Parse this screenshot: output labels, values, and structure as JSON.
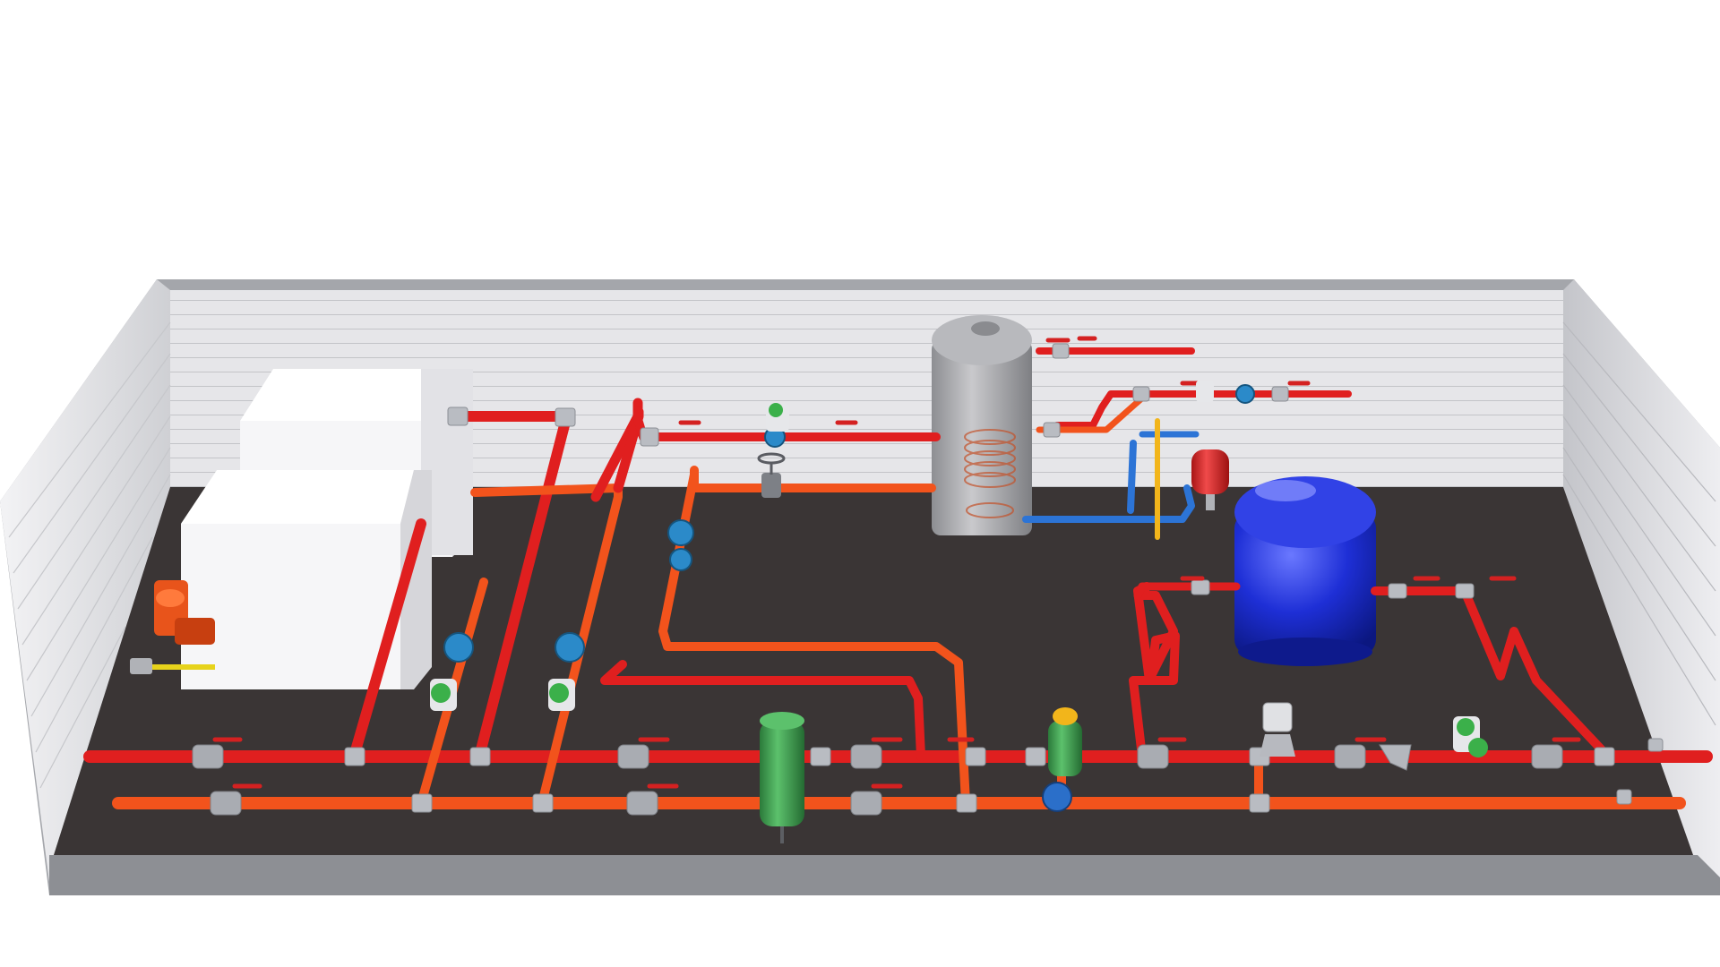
{
  "scene": {
    "subject": "boiler-room-piping-layout",
    "colors": {
      "background": "#ffffff",
      "wall_panel": "#e9e9ec",
      "wall_edge": "#9fa1a6",
      "floor": "#3a3535",
      "pipe_hot": "#e01f1f",
      "pipe_return": "#f2531c",
      "pipe_cold": "#2c74d6",
      "fitting": "#b9bcc2",
      "boiler": "#f6f6f8",
      "burner": "#e8541b",
      "tank_grey": "#a8a9ad",
      "expansion_vessel_blue": "#1e2fd6",
      "expansion_vessel_red": "#d92b2b",
      "hydraulic_separator": "#3c9a4b",
      "pump_body": "#2b8ac9",
      "valve_handle": "#d42121"
    }
  }
}
